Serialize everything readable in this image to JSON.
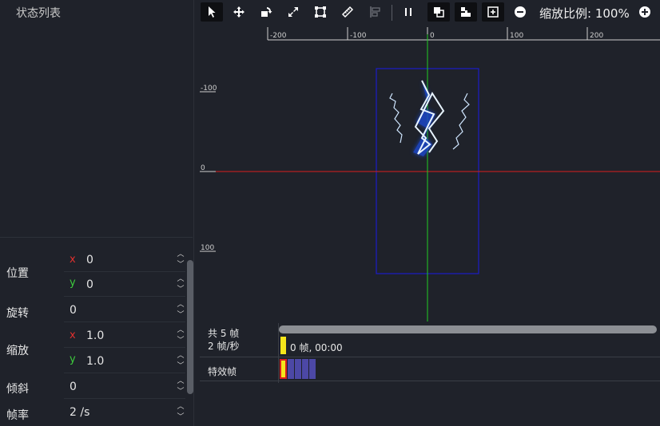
{
  "state_list": {
    "title": "状态列表"
  },
  "properties": {
    "position_label": "位置",
    "position_x": "0",
    "position_y": "0",
    "rotation_label": "旋转",
    "rotation": "0",
    "scale_label": "缩放",
    "scale_x": "1.0",
    "scale_y": "1.0",
    "skew_label": "倾斜",
    "skew": "0",
    "framerate_label": "帧率",
    "framerate": "2 /s",
    "x_axis": "x",
    "y_axis": "y"
  },
  "toolbar": {
    "icons": [
      "select-pointer-icon",
      "move-icon",
      "rotate-icon",
      "scale-icon",
      "bounding-box-icon",
      "ruler-icon",
      "align-icon",
      "pause-icon",
      "layer-order-icon",
      "anchor-icon",
      "add-frame-icon",
      "zoom-out-icon",
      "zoom-in-icon"
    ],
    "zoom_label": "缩放比例:",
    "zoom_value": "100%"
  },
  "canvas": {
    "ruler_x": [
      "-200",
      "-100",
      "0",
      "100",
      "200"
    ],
    "ruler_y": [
      "-100",
      "0",
      "100"
    ],
    "colors": {
      "x_axis": "#d81e1e",
      "y_axis": "#22cc22",
      "bbox": "#1c1cc8",
      "background": "#1f222a"
    }
  },
  "timeline": {
    "total_frames": "共 5 帧",
    "fps": "2 帧/秒",
    "current": "0 帧, 00:00",
    "layer_name": "特效帧",
    "frame_count": 5,
    "current_frame": 0
  }
}
